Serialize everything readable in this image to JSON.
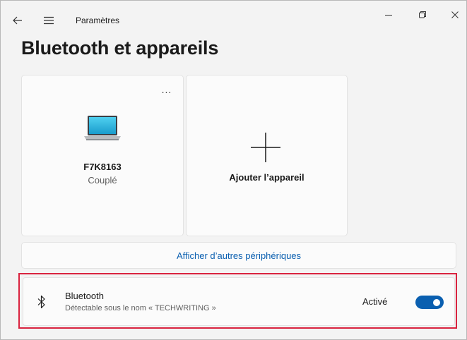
{
  "window": {
    "title": "Paramètres",
    "minimize_icon": "minimize-icon",
    "maximize_icon": "restore-icon",
    "close_icon": "close-icon"
  },
  "nav": {
    "back_icon": "back-arrow-icon",
    "menu_icon": "hamburger-menu-icon"
  },
  "page": {
    "title": "Bluetooth et appareils"
  },
  "devices": [
    {
      "name": "F7K8163",
      "status": "Couplé",
      "icon": "laptop-icon",
      "more_label": "..."
    }
  ],
  "add_device": {
    "label": "Ajouter l’appareil",
    "icon": "plus-icon"
  },
  "more_devices": {
    "label": "Afficher d’autres périphériques"
  },
  "bluetooth": {
    "title": "Bluetooth",
    "subtitle": "Détectable sous le nom « TECHWRITING »",
    "state_label": "Activé",
    "enabled": true,
    "icon": "bluetooth-icon"
  },
  "colors": {
    "accent": "#0a5fb0",
    "highlight": "#d9233f"
  }
}
